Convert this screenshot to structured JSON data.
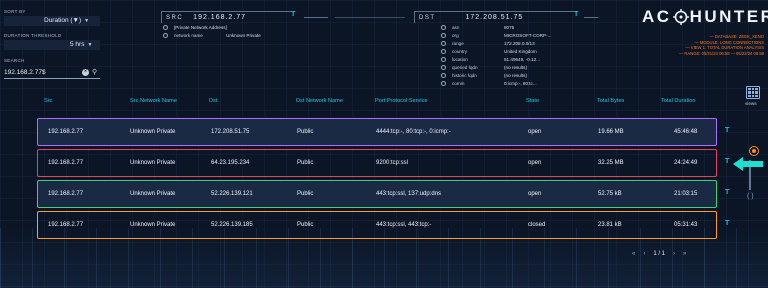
{
  "sidebar": {
    "sort_label": "SORT BY",
    "sort_value": "Duration (▼)",
    "threshold_label": "DURATION THRESHOLD",
    "threshold_value": "5 hrs",
    "search_label": "SEARCH",
    "search_value": "192.168.2.77$"
  },
  "src_panel": {
    "tag": "SRC",
    "ip": "192.168.2.77",
    "filter": "T",
    "rows": [
      {
        "key": "",
        "value": "[Private Network Address]"
      },
      {
        "key": "network name",
        "value": "Unknown Private"
      }
    ]
  },
  "dst_panel": {
    "tag": "DST",
    "ip": "172.208.51.75",
    "filter": "T",
    "rows": [
      {
        "key": "asn",
        "value": "8075"
      },
      {
        "key": "org",
        "value": "MICROSOFT-CORP-..."
      },
      {
        "key": "range",
        "value": "172.208.0.0/13"
      },
      {
        "key": "country",
        "value": "United Kingdom"
      },
      {
        "key": "location",
        "value": "51.49649, -0.12..."
      },
      {
        "key": "queried fqdn",
        "value": "(no results)"
      },
      {
        "key": "historic fqdn",
        "value": "(no results)"
      },
      {
        "key": "comm",
        "value": "0:icmp:-, 80:tc..."
      }
    ]
  },
  "logo": {
    "text_left": "AC",
    "text_right": "HUNTER",
    "notes": [
      "— DATABASE: ZEEK_XENO",
      "— MODULE: LONG CONNECTIONS",
      "— VIEW 1: TOTAL DURATION ANALYSIS",
      "— RANGE: 05/21/24 06:58 — 05/22/24 06:58"
    ]
  },
  "views_label": "views",
  "table": {
    "headers": [
      "Src",
      "Src Network Name",
      "Dst",
      "Dst Network Name",
      "Port:Protocol:Service",
      "State",
      "Total Bytes",
      "Total Duration"
    ],
    "rows": [
      {
        "src": "192.168.2.77",
        "src_net": "Unknown Private",
        "dst": "172.208.51.75",
        "dst_net": "Public",
        "pps": "4444:tcp:-, 80:tcp:-, 0:icmp:-",
        "state": "open",
        "bytes": "19.66 MB",
        "duration": "45:46:48",
        "filter": "T"
      },
      {
        "src": "192.168.2.77",
        "src_net": "Unknown Private",
        "dst": "64.23.195.234",
        "dst_net": "Public",
        "pps": "9200:tcp:ssl",
        "state": "open",
        "bytes": "32.25 MB",
        "duration": "24:24:49",
        "filter": "T"
      },
      {
        "src": "192.168.2.77",
        "src_net": "Unknown Private",
        "dst": "52.226.139.121",
        "dst_net": "Public",
        "pps": "443:tcp:ssl, 137:udp:dns",
        "state": "open",
        "bytes": "52.75 kB",
        "duration": "21:03:15",
        "filter": "T"
      },
      {
        "src": "192.168.2.77",
        "src_net": "Unknown Private",
        "dst": "52.226.139.185",
        "dst_net": "Public",
        "pps": "443:tcp:ssl, 443:tcp:-",
        "state": "closed",
        "bytes": "23.81 kB",
        "duration": "05:31:43",
        "filter": "T"
      }
    ]
  },
  "pagination": {
    "text": "1 / 1"
  },
  "colors": {
    "row1": "#a970ff",
    "row2": "#e0475a",
    "row3": "#3dd17a",
    "row4": "#ff9d2a",
    "accent": "#16c2d4"
  }
}
